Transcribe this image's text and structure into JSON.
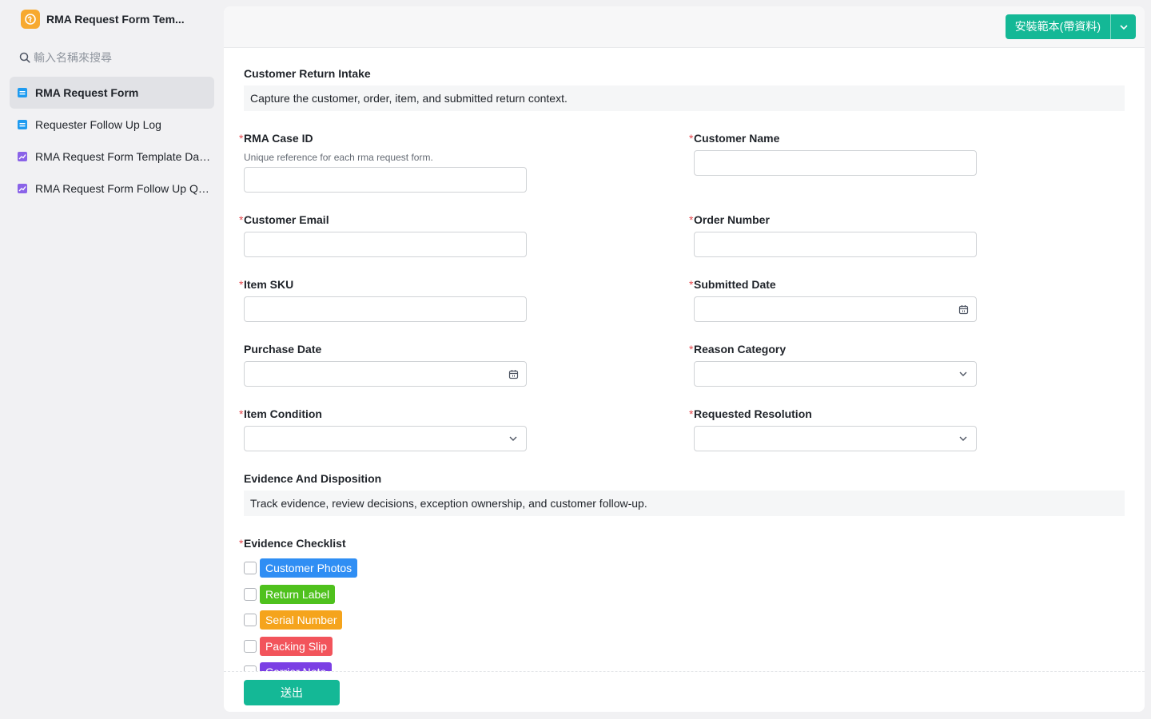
{
  "app": {
    "title": "RMA Request Form Tem..."
  },
  "search": {
    "placeholder": "輸入名稱來搜尋"
  },
  "sidebar": {
    "items": [
      {
        "label": "RMA Request Form",
        "icon": "form-icon",
        "active": true
      },
      {
        "label": "Requester Follow Up Log",
        "icon": "form-icon",
        "active": false
      },
      {
        "label": "RMA Request Form Template Das...",
        "icon": "dashboard-icon",
        "active": false
      },
      {
        "label": "RMA Request Form Follow Up Qu...",
        "icon": "dashboard-icon",
        "active": false
      }
    ]
  },
  "toolbar": {
    "install_label": "安裝範本(帶資料)"
  },
  "form": {
    "section1": {
      "title": "Customer Return Intake",
      "description": "Capture the customer, order, item, and submitted return context."
    },
    "fields": {
      "rma_case_id": {
        "label": "RMA Case ID",
        "hint": "Unique reference for each rma request form.",
        "required": true,
        "value": ""
      },
      "customer_name": {
        "label": "Customer Name",
        "required": true,
        "value": ""
      },
      "customer_email": {
        "label": "Customer Email",
        "required": true,
        "value": ""
      },
      "order_number": {
        "label": "Order Number",
        "required": true,
        "value": ""
      },
      "item_sku": {
        "label": "Item SKU",
        "required": true,
        "value": ""
      },
      "submitted_date": {
        "label": "Submitted Date",
        "required": true,
        "value": ""
      },
      "purchase_date": {
        "label": "Purchase Date",
        "required": false,
        "value": ""
      },
      "reason_category": {
        "label": "Reason Category",
        "required": true,
        "value": ""
      },
      "item_condition": {
        "label": "Item Condition",
        "required": true,
        "value": ""
      },
      "requested_resolution": {
        "label": "Requested Resolution",
        "required": true,
        "value": ""
      }
    },
    "section2": {
      "title": "Evidence And Disposition",
      "description": "Track evidence, review decisions, exception ownership, and customer follow-up."
    },
    "evidence_checklist": {
      "label": "Evidence Checklist",
      "required": true,
      "options": [
        {
          "label": "Customer Photos",
          "color": "#2f8ef4",
          "checked": false
        },
        {
          "label": "Return Label",
          "color": "#4fc11d",
          "checked": false
        },
        {
          "label": "Serial Number",
          "color": "#f5a41c",
          "checked": false
        },
        {
          "label": "Packing Slip",
          "color": "#f2545b",
          "checked": false
        },
        {
          "label": "Carrier Note",
          "color": "#7b3fe4",
          "checked": false
        }
      ]
    },
    "submit_label": "送出"
  },
  "colors": {
    "accent": "#14b896",
    "required": "#e5484d",
    "logo": "#f7a92f"
  }
}
